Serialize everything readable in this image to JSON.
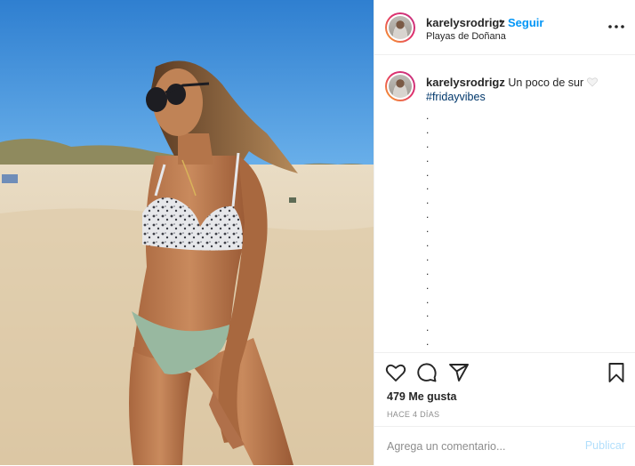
{
  "post": {
    "author": "karelysrodrigz",
    "follow_label": "Seguir",
    "separator": "•",
    "location": "Playas de Doñana",
    "caption_text": "Un poco de sur",
    "hashtag": "#fridayvibes",
    "caption_dots": [
      ".",
      ".",
      ".",
      ".",
      ".",
      ".",
      ".",
      ".",
      ".",
      ".",
      ".",
      ".",
      ".",
      ".",
      ".",
      ".",
      "."
    ],
    "likes": "479 Me gusta",
    "time": "HACE 4 DÍAS"
  },
  "comment_box": {
    "placeholder": "Agrega un comentario...",
    "publish_label": "Publicar"
  },
  "icons": [
    "heart-icon",
    "comment-icon",
    "share-icon",
    "bookmark-icon",
    "more-options-icon"
  ],
  "colors": {
    "link_blue": "#0095f6",
    "publish_disabled": "#b2dffc",
    "hashtag": "#00376b",
    "muted": "#8e8e8e",
    "border": "#efefef"
  }
}
